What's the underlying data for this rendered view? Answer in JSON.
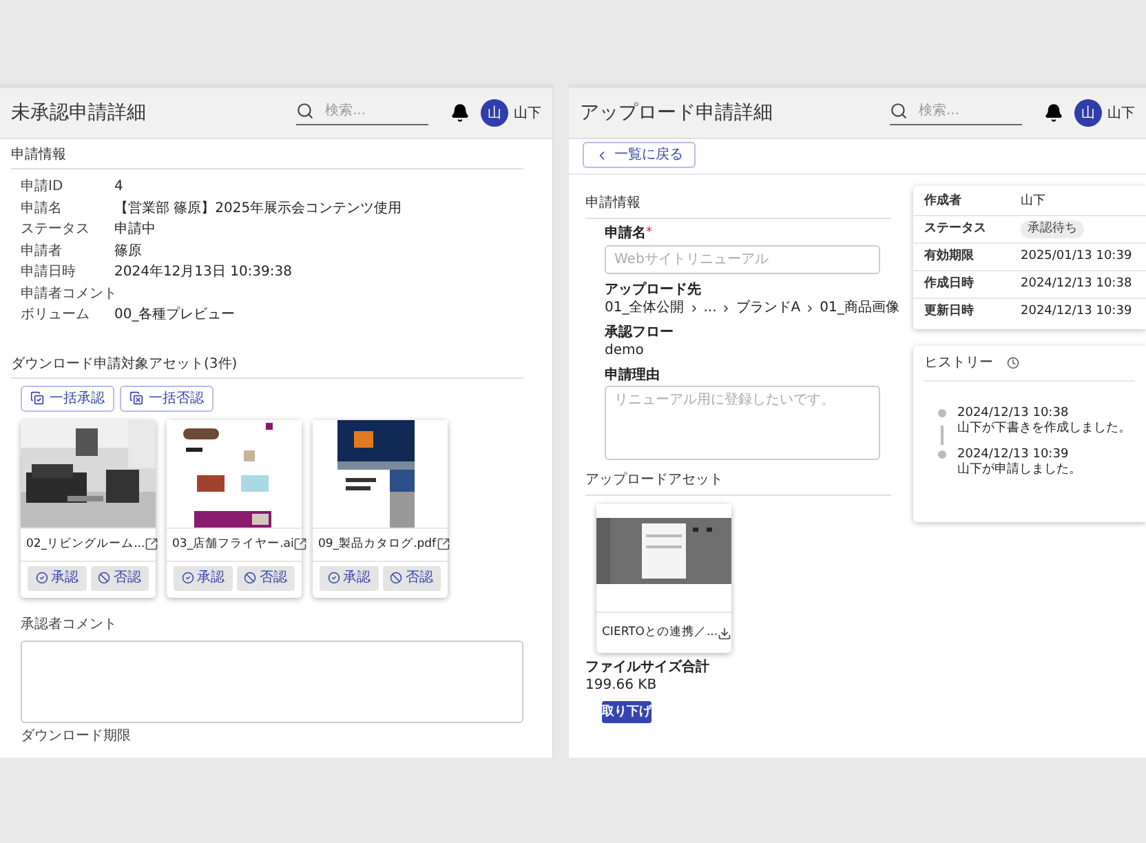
{
  "left_screen": {
    "header": {
      "title": "未承認申請詳細",
      "search_placeholder": "検索...",
      "avatar": "山",
      "user": "山下"
    },
    "info": {
      "title": "申請情報",
      "rows": [
        {
          "label": "申請ID",
          "value": "4"
        },
        {
          "label": "申請名",
          "value": "【営業部 篠原】2025年展示会コンテンツ使用"
        },
        {
          "label": "ステータス",
          "value": "申請中"
        },
        {
          "label": "申請者",
          "value": "篠原"
        },
        {
          "label": "申請日時",
          "value": "2024年12月13日 10:39:38"
        },
        {
          "label": "申請者コメント"
        },
        {
          "label": "ボリューム",
          "value": "00_各種プレビュー"
        }
      ]
    },
    "assets": {
      "title": "ダウンロード申請対象アセット(3件)",
      "bulk_approve": "一括承認",
      "bulk_reject": "一括否認",
      "cards": [
        {
          "name": "02_リビングルーム...",
          "approve": "承認",
          "reject": "否認"
        },
        {
          "name": "03_店舗フライヤー.ai",
          "approve": "承認",
          "reject": "否認"
        },
        {
          "name": "09_製品カタログ.pdf",
          "approve": "承認",
          "reject": "否認"
        }
      ]
    },
    "comment_label": "承認者コメント",
    "deadline_label": "ダウンロード期限"
  },
  "right_screen": {
    "header": {
      "title": "アップロード申請詳細",
      "search_placeholder": "検索...",
      "avatar": "山",
      "user": "山下"
    },
    "back_button": "一覧に戻る",
    "form": {
      "title": "申請情報",
      "name_field": {
        "label": "申請名",
        "required": true,
        "required_mark": "*",
        "placeholder": "Webサイトリニューアル"
      },
      "destination": {
        "label": "アップロード先",
        "path": [
          "01_全体公開",
          "...",
          "ブランドA",
          "01_商品画像"
        ]
      },
      "flow": {
        "label": "承認フロー",
        "value": "demo"
      },
      "reason_field": {
        "label": "申請理由",
        "placeholder": "リニューアル用に登録したいです。"
      },
      "assets_title": "アップロードアセット",
      "asset": {
        "name": "CIERTOとの連携／..."
      },
      "file_size": {
        "label": "ファイルサイズ合計",
        "value": "199.66 KB"
      },
      "withdraw_button": "取り下げ"
    },
    "details": [
      {
        "label": "作成者",
        "value": "山下",
        "kind": "text"
      },
      {
        "label": "ステータス",
        "value": "承認待ち",
        "kind": "badge"
      },
      {
        "label": "有効期限",
        "value": "2025/01/13 10:39",
        "kind": "text"
      },
      {
        "label": "作成日時",
        "value": "2024/12/13 10:38",
        "kind": "text"
      },
      {
        "label": "更新日時",
        "value": "2024/12/13 10:39",
        "kind": "text"
      }
    ],
    "history": {
      "title": "ヒストリー",
      "entries": [
        {
          "time": "2024/12/13 10:38",
          "text": "山下が下書きを作成しました。"
        },
        {
          "time": "2024/12/13 10:39",
          "text": "山下が申請しました。"
        }
      ]
    }
  }
}
